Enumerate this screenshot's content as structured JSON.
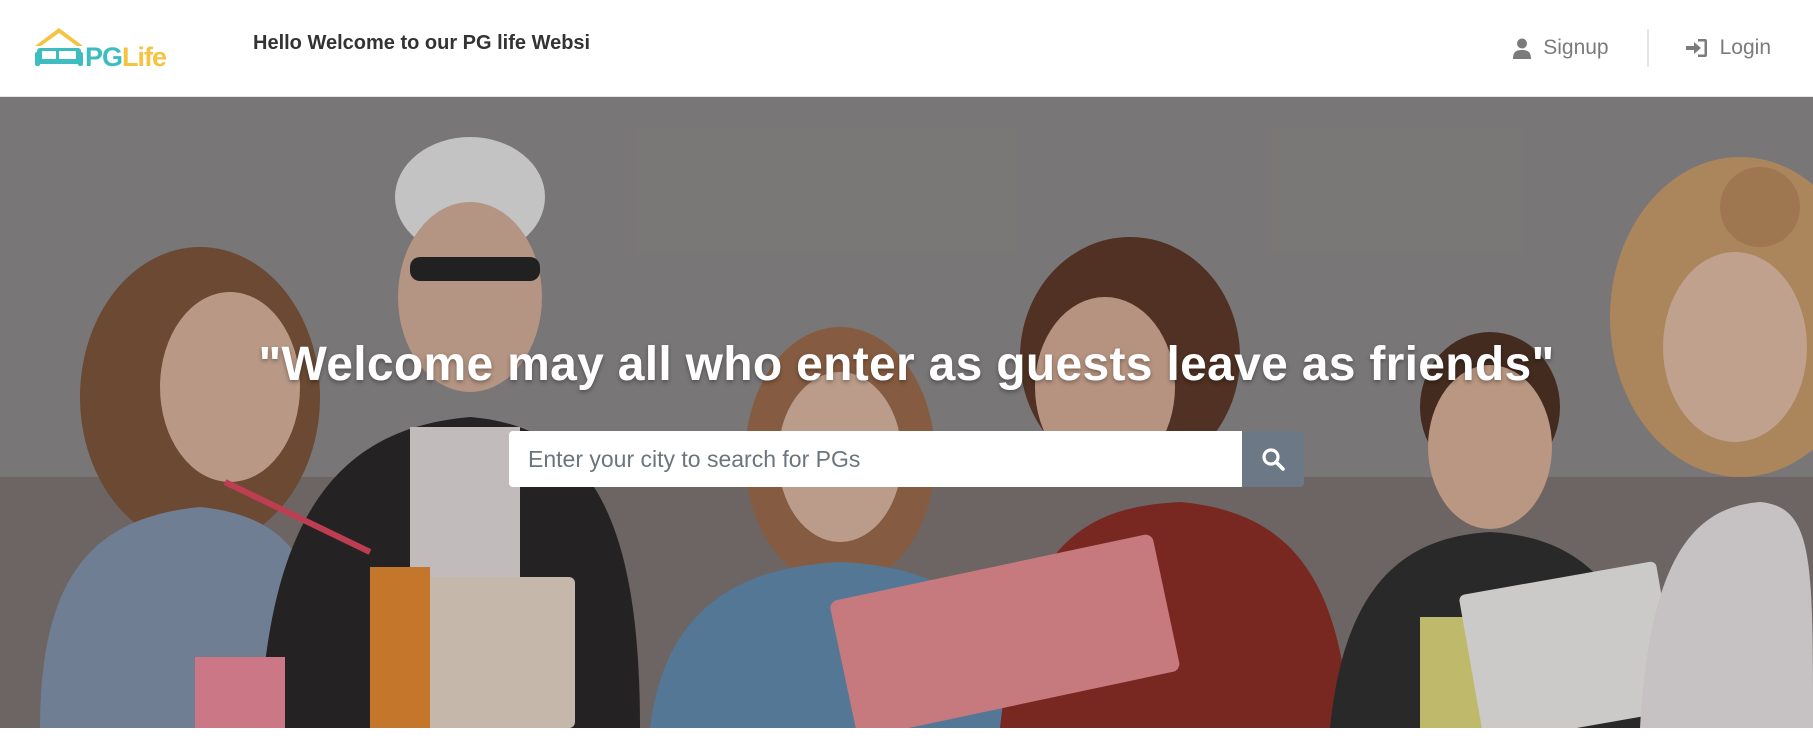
{
  "brand": {
    "pg": "PG",
    "life": "Life",
    "primary_color": "#3dbdbf",
    "accent_color": "#f5c342"
  },
  "header": {
    "welcome_message": "Hello Welcome to our PG life Websi"
  },
  "nav": {
    "signup_label": "Signup",
    "login_label": "Login",
    "signup_icon": "user-icon",
    "login_icon": "sign-in-icon"
  },
  "hero": {
    "quote": "\"Welcome may all who enter as guests leave as friends\"",
    "search": {
      "placeholder": "Enter your city to search for PGs",
      "value": "",
      "button_icon": "search-icon",
      "button_color": "#6c7885"
    }
  }
}
